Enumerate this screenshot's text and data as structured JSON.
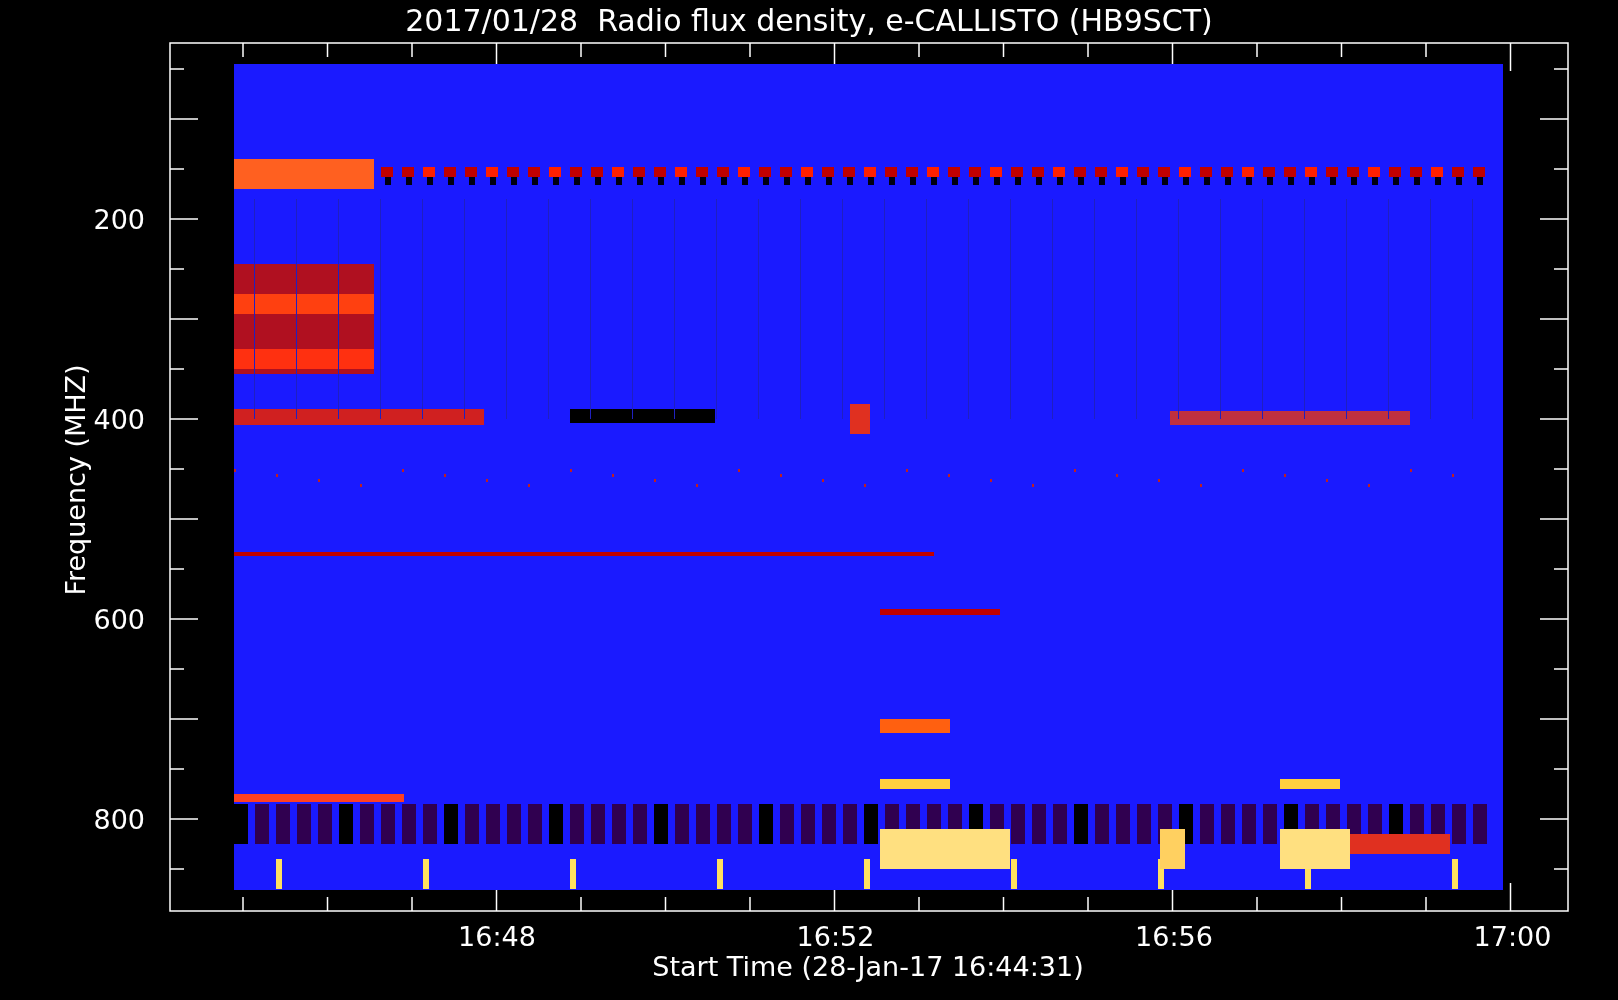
{
  "title": "2017/01/28  Radio flux density, e-CALLISTO (HB9SCT)",
  "plot": {
    "ylabel": "Frequency (MHZ)",
    "xlabel": "Start Time (28-Jan-17 16:44:31)",
    "yticks": [
      "200",
      "400",
      "600",
      "800"
    ],
    "xticks": [
      "16:48",
      "16:52",
      "16:56",
      "17:00"
    ]
  }
}
